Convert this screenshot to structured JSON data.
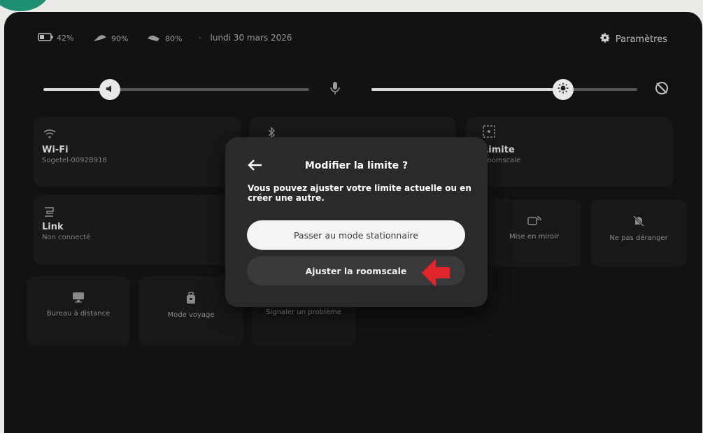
{
  "status": {
    "battery": "42%",
    "controller_right": "90%",
    "controller_left": "80%",
    "separator": "·",
    "date": "lundi 30 mars 2026",
    "settings_label": "Paramètres"
  },
  "tiles": {
    "wifi": {
      "title": "Wi-Fi",
      "subtitle": "Sogetel-0092B918"
    },
    "limit": {
      "title": "Limite",
      "subtitle": "Roomscale"
    },
    "link": {
      "title": "Link",
      "subtitle": "Non connecté"
    },
    "mirror": {
      "label": "Mise en miroir"
    },
    "dnd": {
      "label": "Ne pas déranger"
    },
    "remote": {
      "label": "Bureau à distance"
    },
    "travel": {
      "label": "Mode voyage"
    },
    "report": {
      "label": "Signaler un problème"
    }
  },
  "sliders": {
    "volume_level": 0.25,
    "brightness_level": 0.72
  },
  "dialog": {
    "title": "Modifier la limite ?",
    "body": "Vous pouvez ajuster votre limite actuelle ou en créer une autre.",
    "primary_button": "Passer au mode stationnaire",
    "secondary_button": "Ajuster la roomscale"
  },
  "colors": {
    "accent_red": "#e0262b",
    "badge_green": "#1f8f72",
    "panel_bg": "#121212",
    "dialog_bg": "#2a2a2c"
  },
  "icons": [
    "battery-icon",
    "controller-icon",
    "gear-icon",
    "speaker-icon",
    "microphone-icon",
    "sun-icon",
    "eye-off-icon",
    "wifi-icon",
    "bluetooth-icon",
    "boundary-icon",
    "link-icon",
    "cast-icon",
    "bell-off-icon",
    "desktop-icon",
    "luggage-icon",
    "back-arrow-icon",
    "red-arrow-icon"
  ]
}
